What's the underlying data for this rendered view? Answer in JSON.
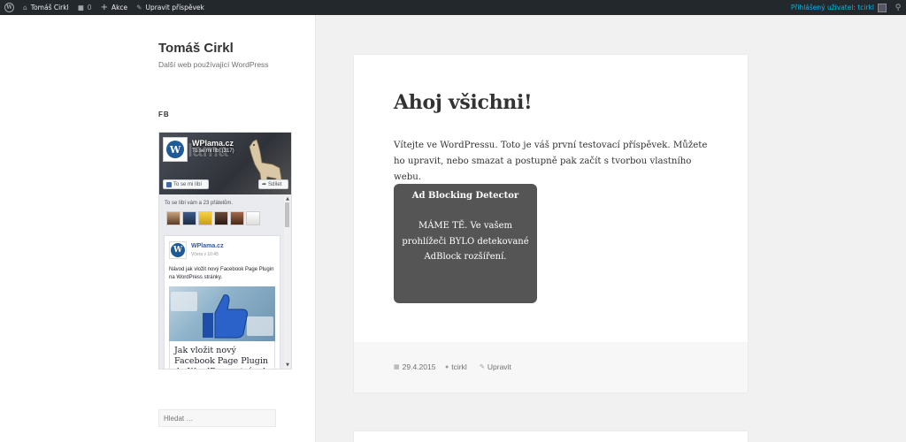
{
  "adminbar": {
    "site_name": "Tomáš Cirkl",
    "comments_count": "0",
    "new_label": "Akce",
    "edit_label": "Upravit příspěvek",
    "account_label": "Přihlášený uživatel: tcirkl"
  },
  "site": {
    "title": "Tomáš Cirkl",
    "description": "Další web používající WordPress"
  },
  "widget": {
    "title": "FB"
  },
  "fb": {
    "cover_text": "plama",
    "page_name": "WPlama.cz",
    "page_likes": "To se mi líbí (317)",
    "like_button": "To se mi líbí",
    "share_button": "Sdílet",
    "friends_text": "To se líbí vám a 23 přátelům.",
    "post_author": "WPlama.cz",
    "post_time": "Včera v 10:45",
    "post_text": "Návod jak vložit nový Facebook Page Plugin na WordPress stránky.",
    "post_link_title": "Jak vložit nový Facebook Page Plugin do WordPress stránek"
  },
  "search": {
    "placeholder": "Hledat …"
  },
  "post": {
    "title": "Ahoj všichni!",
    "body": "Vítejte ve WordPressu. Toto je váš první testovací příspěvek. Můžete ho upravit, nebo smazat a postupně pak začít s tvorbou vlastního webu.",
    "adblock_title": "Ad Blocking Detector",
    "adblock_message": "MÁME TĚ. Ve vašem prohlížeči BYLO detekované AdBlock rozšíření.",
    "date": "29.4.2015",
    "author": "tcirkl",
    "edit": "Upravit"
  },
  "colors": {
    "adminbar_bg": "#23282d",
    "account_link": "#00b9eb",
    "adblock_bg": "#555555",
    "page_bg": "#f1f1f1"
  }
}
